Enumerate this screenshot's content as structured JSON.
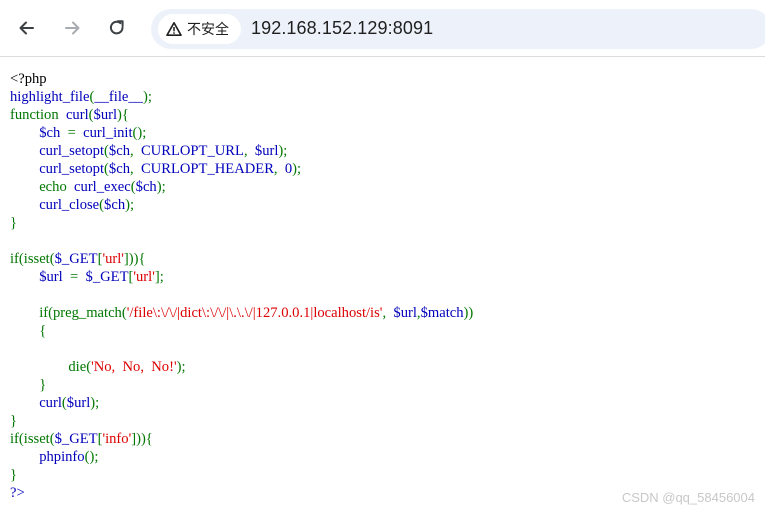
{
  "browser": {
    "security_label": "不安全",
    "url": "192.168.152.129:8091",
    "icons": {
      "back": "back-arrow-icon",
      "forward": "forward-arrow-icon",
      "reload": "reload-icon",
      "security": "warning-triangle-icon"
    }
  },
  "colors": {
    "html": "#000000",
    "default": "#0000BB",
    "keyword": "#007700",
    "string": "#DD0000"
  },
  "code_lines": [
    [
      [
        "html",
        "&lt;?php"
      ]
    ],
    [
      [
        "default",
        "highlight_file"
      ],
      [
        "keyword",
        "("
      ],
      [
        "default",
        "__file__"
      ],
      [
        "keyword",
        ");"
      ]
    ],
    [
      [
        "keyword",
        "function&nbsp;&nbsp;"
      ],
      [
        "default",
        "curl"
      ],
      [
        "keyword",
        "("
      ],
      [
        "default",
        "$url"
      ],
      [
        "keyword",
        "){"
      ]
    ],
    [
      [
        "keyword",
        "&nbsp;&nbsp;&nbsp;&nbsp;&nbsp;&nbsp;&nbsp;&nbsp;"
      ],
      [
        "default",
        "$ch&nbsp;&nbsp;"
      ],
      [
        "keyword",
        "=&nbsp;&nbsp;"
      ],
      [
        "default",
        "curl_init"
      ],
      [
        "keyword",
        "();"
      ]
    ],
    [
      [
        "keyword",
        "&nbsp;&nbsp;&nbsp;&nbsp;&nbsp;&nbsp;&nbsp;&nbsp;"
      ],
      [
        "default",
        "curl_setopt"
      ],
      [
        "keyword",
        "("
      ],
      [
        "default",
        "$ch"
      ],
      [
        "keyword",
        ",&nbsp;&nbsp;"
      ],
      [
        "default",
        "CURLOPT_URL"
      ],
      [
        "keyword",
        ",&nbsp;&nbsp;"
      ],
      [
        "default",
        "$url"
      ],
      [
        "keyword",
        ");"
      ]
    ],
    [
      [
        "keyword",
        "&nbsp;&nbsp;&nbsp;&nbsp;&nbsp;&nbsp;&nbsp;&nbsp;"
      ],
      [
        "default",
        "curl_setopt"
      ],
      [
        "keyword",
        "("
      ],
      [
        "default",
        "$ch"
      ],
      [
        "keyword",
        ",&nbsp;&nbsp;"
      ],
      [
        "default",
        "CURLOPT_HEADER"
      ],
      [
        "keyword",
        ",&nbsp;&nbsp;"
      ],
      [
        "default",
        "0"
      ],
      [
        "keyword",
        ");"
      ]
    ],
    [
      [
        "keyword",
        "&nbsp;&nbsp;&nbsp;&nbsp;&nbsp;&nbsp;&nbsp;&nbsp;echo&nbsp;&nbsp;"
      ],
      [
        "default",
        "curl_exec"
      ],
      [
        "keyword",
        "("
      ],
      [
        "default",
        "$ch"
      ],
      [
        "keyword",
        ");"
      ]
    ],
    [
      [
        "keyword",
        "&nbsp;&nbsp;&nbsp;&nbsp;&nbsp;&nbsp;&nbsp;&nbsp;"
      ],
      [
        "default",
        "curl_close"
      ],
      [
        "keyword",
        "("
      ],
      [
        "default",
        "$ch"
      ],
      [
        "keyword",
        ");"
      ]
    ],
    [
      [
        "keyword",
        "}"
      ]
    ],
    [
      [
        "keyword",
        ""
      ]
    ],
    [
      [
        "keyword",
        "if(isset("
      ],
      [
        "default",
        "$_GET"
      ],
      [
        "keyword",
        "["
      ],
      [
        "string",
        "'url'"
      ],
      [
        "keyword",
        "])){"
      ]
    ],
    [
      [
        "keyword",
        "&nbsp;&nbsp;&nbsp;&nbsp;&nbsp;&nbsp;&nbsp;&nbsp;"
      ],
      [
        "default",
        "$url&nbsp;&nbsp;"
      ],
      [
        "keyword",
        "=&nbsp;&nbsp;"
      ],
      [
        "default",
        "$_GET"
      ],
      [
        "keyword",
        "["
      ],
      [
        "string",
        "'url'"
      ],
      [
        "keyword",
        "];"
      ]
    ],
    [
      [
        "keyword",
        ""
      ]
    ],
    [
      [
        "keyword",
        "&nbsp;&nbsp;&nbsp;&nbsp;&nbsp;&nbsp;&nbsp;&nbsp;if(preg_match("
      ],
      [
        "string",
        "'/file\\:\\/\\/|dict\\:\\/\\/|\\.\\.\\/|127.0.0.1|localhost/is'"
      ],
      [
        "keyword",
        ",&nbsp;&nbsp;"
      ],
      [
        "default",
        "$url"
      ],
      [
        "keyword",
        ","
      ],
      [
        "default",
        "$match"
      ],
      [
        "keyword",
        "))"
      ]
    ],
    [
      [
        "keyword",
        "&nbsp;&nbsp;&nbsp;&nbsp;&nbsp;&nbsp;&nbsp;&nbsp;{"
      ]
    ],
    [
      [
        "keyword",
        ""
      ]
    ],
    [
      [
        "keyword",
        "&nbsp;&nbsp;&nbsp;&nbsp;&nbsp;&nbsp;&nbsp;&nbsp;&nbsp;&nbsp;&nbsp;&nbsp;&nbsp;&nbsp;&nbsp;&nbsp;die("
      ],
      [
        "string",
        "'No,&nbsp;&nbsp;No,&nbsp;&nbsp;No!'"
      ],
      [
        "keyword",
        ");"
      ]
    ],
    [
      [
        "keyword",
        "&nbsp;&nbsp;&nbsp;&nbsp;&nbsp;&nbsp;&nbsp;&nbsp;}"
      ]
    ],
    [
      [
        "keyword",
        "&nbsp;&nbsp;&nbsp;&nbsp;&nbsp;&nbsp;&nbsp;&nbsp;"
      ],
      [
        "default",
        "curl"
      ],
      [
        "keyword",
        "("
      ],
      [
        "default",
        "$url"
      ],
      [
        "keyword",
        ");"
      ]
    ],
    [
      [
        "keyword",
        "}"
      ]
    ],
    [
      [
        "keyword",
        "if(isset("
      ],
      [
        "default",
        "$_GET"
      ],
      [
        "keyword",
        "["
      ],
      [
        "string",
        "'info'"
      ],
      [
        "keyword",
        "])){"
      ]
    ],
    [
      [
        "keyword",
        "&nbsp;&nbsp;&nbsp;&nbsp;&nbsp;&nbsp;&nbsp;&nbsp;"
      ],
      [
        "default",
        "phpinfo"
      ],
      [
        "keyword",
        "();"
      ]
    ],
    [
      [
        "keyword",
        "}"
      ]
    ],
    [
      [
        "default",
        "?&gt;"
      ]
    ]
  ],
  "watermark": "CSDN @qq_58456004"
}
